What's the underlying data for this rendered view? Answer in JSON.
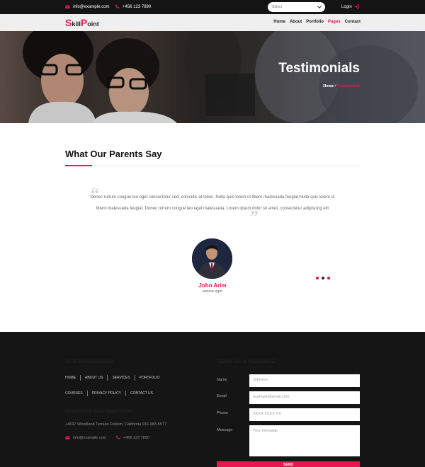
{
  "topbar": {
    "email": "info@example.com",
    "phone": "+456 123 7890",
    "select_value": "Select",
    "login_label": "Login"
  },
  "nav": {
    "logo_initial": "S",
    "logo_text": "kill",
    "logo_initial2": "P",
    "logo_text2": "oint",
    "items": [
      "Home",
      "About",
      "Portfolio",
      "Pages",
      "Contact"
    ],
    "active": "Pages"
  },
  "hero": {
    "title": "Testimonials",
    "crumb_home": "Home",
    "crumb_sep": "/",
    "crumb_current": "Testimonials"
  },
  "testimonials": {
    "heading": "What Our Parents Say",
    "quote": "Donec rutrum congue leo eget consectetur sed, convallis at tellus. Nulla quis lorem ut libero malesuada feugiat.Nulla quis lorem ut libero malesuada feugiat. Donec rutrum congue leo eget malesuada. Lorem ipsum dolor sit amet, consectetur adipiscing elit",
    "name": "John Arim",
    "role": "lacinia eget",
    "dots_count": 3,
    "active_dot": 2
  },
  "footer": {
    "nav_heading": "SITE NAVIGATION",
    "links_row1": [
      "HOME",
      "ABOUT US",
      "SERVICES",
      "PORTFOLIO"
    ],
    "links_row2": [
      "COURSES",
      "PRIVACY POLICY",
      "CONTACT US"
    ],
    "contact_heading": "CONTACT INFORMATION",
    "address": "+4697 Woodland Terrace Folsom, California 916-983-6577",
    "email": "info@example.com",
    "phone": "+456 123 7890",
    "form_heading": "SEND US A MESSAGE",
    "name_label": "Name",
    "name_value": "Johnson",
    "email_label": "Email",
    "email_placeholder": "example@email.com",
    "phone_label": "Phone",
    "phone_placeholder": "XXXX XXXX XX",
    "message_label": "Message",
    "message_placeholder": "Your message",
    "send_label": "SEND"
  },
  "colors": {
    "accent": "#e8174f",
    "dark": "#151515"
  }
}
